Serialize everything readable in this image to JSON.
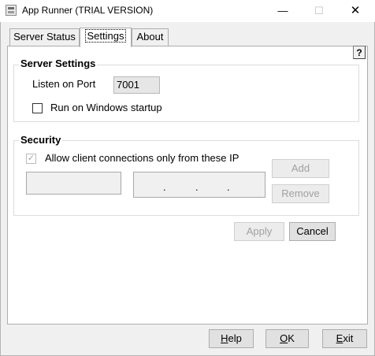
{
  "window": {
    "title": "App Runner (TRIAL VERSION)",
    "controls": {
      "minimize": "—",
      "maximize": "☐",
      "close": "✕"
    }
  },
  "tabs": [
    {
      "label": "Server Status",
      "active": false
    },
    {
      "label": "Settings",
      "active": true
    },
    {
      "label": "About",
      "active": false
    }
  ],
  "help_corner": "?",
  "server_settings": {
    "title": "Server Settings",
    "port_label": "Listen on Port",
    "port_value": "7001",
    "startup_label": "Run on Windows startup",
    "startup_checked": false
  },
  "security": {
    "title": "Security",
    "allow_ip_label": "Allow client connections only from these IP",
    "allow_ip_checked": true,
    "ip_placeholder": ".   .   .",
    "add_label": "Add",
    "remove_label": "Remove"
  },
  "actions": {
    "apply_label": "Apply",
    "cancel_label": "Cancel"
  },
  "bottom": {
    "help_first": "H",
    "help_rest": "elp",
    "ok_first": "O",
    "ok_rest": "K",
    "exit_first": "E",
    "exit_rest": "xit"
  },
  "colors": {
    "panel_bg": "#f0f0f0",
    "disabled_text": "#a0a0a0"
  }
}
